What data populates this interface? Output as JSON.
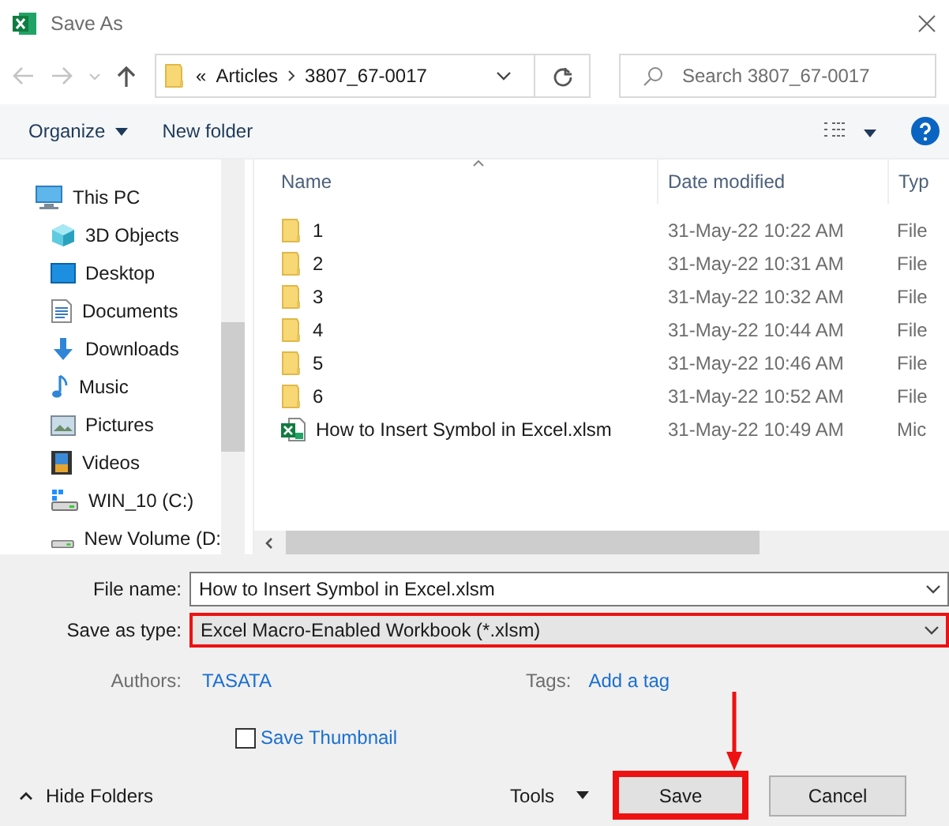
{
  "window": {
    "title": "Save As"
  },
  "address": {
    "overflow": "«",
    "path": [
      "Articles",
      "3807_67-0017"
    ]
  },
  "search": {
    "placeholder": "Search 3807_67-0017"
  },
  "toolbar": {
    "organize": "Organize",
    "new_folder": "New folder"
  },
  "sidebar": {
    "items": [
      {
        "kind": "pc",
        "label": "This PC",
        "children": [
          {
            "kind": "cube",
            "label": "3D Objects"
          },
          {
            "kind": "desktop",
            "label": "Desktop"
          },
          {
            "kind": "documents",
            "label": "Documents"
          },
          {
            "kind": "downloads",
            "label": "Downloads"
          },
          {
            "kind": "music",
            "label": "Music"
          },
          {
            "kind": "pictures",
            "label": "Pictures"
          },
          {
            "kind": "videos",
            "label": "Videos"
          },
          {
            "kind": "drive-win",
            "label": "WIN_10 (C:)"
          },
          {
            "kind": "drive",
            "label": "New Volume (D:"
          }
        ]
      }
    ]
  },
  "file_list": {
    "columns": [
      "Name",
      "Date modified",
      "Typ"
    ],
    "rows": [
      {
        "kind": "folder",
        "name": "1",
        "date": "31-May-22 10:22 AM",
        "type": "File"
      },
      {
        "kind": "folder",
        "name": "2",
        "date": "31-May-22 10:31 AM",
        "type": "File"
      },
      {
        "kind": "folder",
        "name": "3",
        "date": "31-May-22 10:32 AM",
        "type": "File"
      },
      {
        "kind": "folder",
        "name": "4",
        "date": "31-May-22 10:44 AM",
        "type": "File"
      },
      {
        "kind": "folder",
        "name": "5",
        "date": "31-May-22 10:46 AM",
        "type": "File"
      },
      {
        "kind": "folder",
        "name": "6",
        "date": "31-May-22 10:52 AM",
        "type": "File"
      },
      {
        "kind": "excel",
        "name": "How to Insert Symbol in Excel.xlsm",
        "date": "31-May-22 10:49 AM",
        "type": "Mic"
      }
    ]
  },
  "form": {
    "file_name": {
      "label": "File name:",
      "value": "How to Insert Symbol in Excel.xlsm",
      "highlighted": false
    },
    "save_as_type": {
      "label": "Save as type:",
      "value": "Excel Macro-Enabled Workbook (*.xlsm)",
      "highlighted": true
    },
    "authors": {
      "label": "Authors:",
      "value": "TASATA"
    },
    "tags": {
      "label": "Tags:",
      "link": "Add a tag"
    },
    "save_thumbnail": {
      "label": "Save Thumbnail",
      "checked": false
    }
  },
  "footer": {
    "hide_folders": "Hide Folders",
    "tools": "Tools",
    "buttons": [
      {
        "label": "Save",
        "highlighted": true,
        "pointer": true
      },
      {
        "label": "Cancel",
        "highlighted": false,
        "pointer": false
      }
    ]
  }
}
